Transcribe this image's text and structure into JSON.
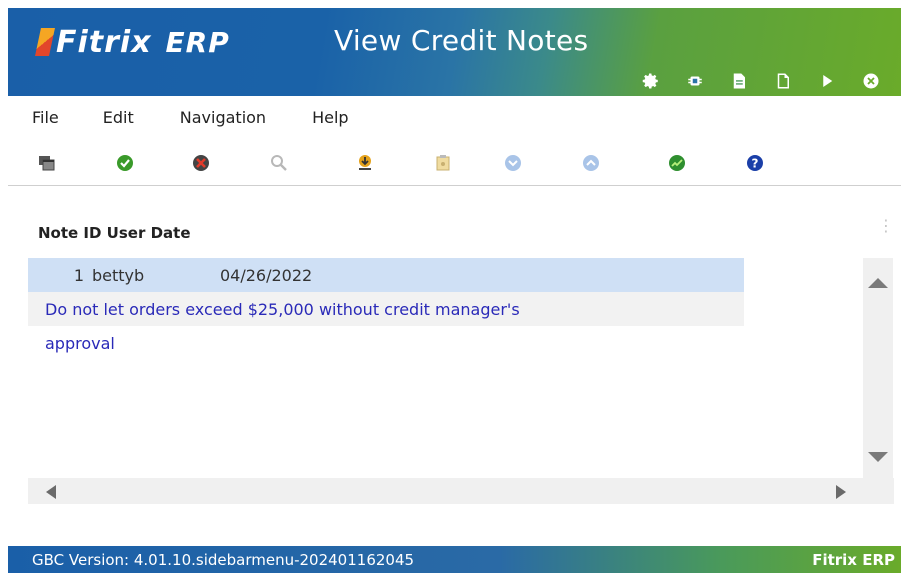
{
  "header": {
    "logo_text": "Fitrix",
    "logo_suffix": "ERP",
    "title": "View Credit Notes",
    "actions": [
      {
        "icon": "gear-icon"
      },
      {
        "icon": "chip-icon"
      },
      {
        "icon": "document-lines-icon"
      },
      {
        "icon": "blank-page-icon"
      },
      {
        "icon": "play-icon"
      },
      {
        "icon": "close-circle-icon"
      }
    ]
  },
  "menu": {
    "file": "File",
    "edit": "Edit",
    "navigation": "Navigation",
    "help": "Help"
  },
  "toolbar": [
    {
      "icon": "window-stack-icon"
    },
    {
      "icon": "accept-check-icon"
    },
    {
      "icon": "cancel-x-icon"
    },
    {
      "icon": "search-magnifier-icon"
    },
    {
      "icon": "download-print-icon"
    },
    {
      "icon": "clipboard-icon"
    },
    {
      "icon": "arrow-down-circle-icon"
    },
    {
      "icon": "arrow-up-circle-icon"
    },
    {
      "icon": "chart-up-icon"
    },
    {
      "icon": "help-question-icon"
    }
  ],
  "grid": {
    "header": "Note ID User Date",
    "rows": [
      {
        "note_id": "1",
        "user": "bettyb",
        "date": "04/26/2022"
      }
    ],
    "note_line1": "Do not let orders exceed $25,000 without credit manager's",
    "note_line2": "approval"
  },
  "status": {
    "version": "GBC Version: 4.01.10.sidebarmenu-202401162045",
    "brand": "Fitrix ERP"
  },
  "colors": {
    "header_blue": "#1a5fa8",
    "header_green": "#6aab2a",
    "selected_row": "#cfe0f5",
    "note_text": "#2a2ab8"
  }
}
